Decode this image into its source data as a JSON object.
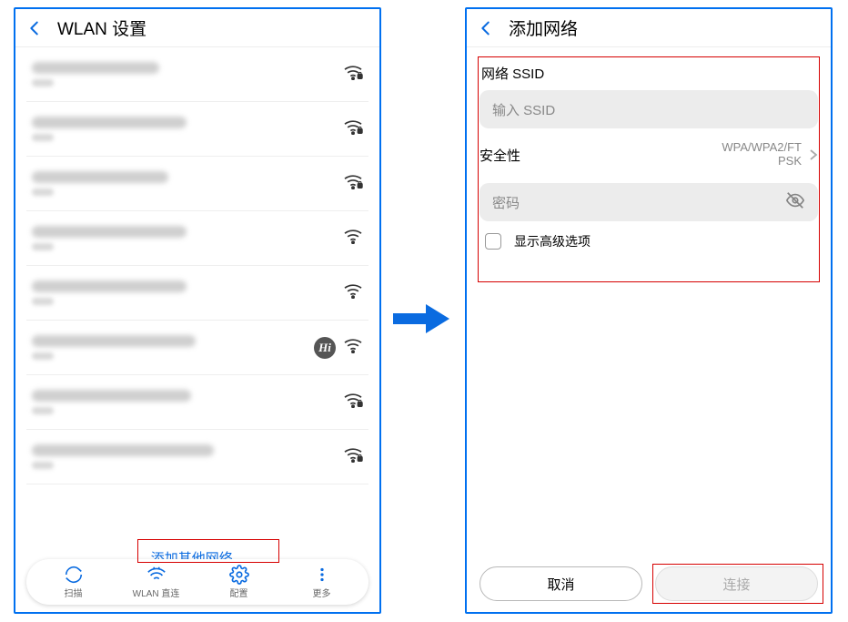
{
  "left": {
    "header_title": "WLAN 设置",
    "wifi_items": [
      {
        "name_width": 140,
        "has_lock": true,
        "hi": false
      },
      {
        "name_width": 170,
        "has_lock": true,
        "hi": false
      },
      {
        "name_width": 150,
        "has_lock": true,
        "hi": false
      },
      {
        "name_width": 170,
        "has_lock": false,
        "hi": false
      },
      {
        "name_width": 170,
        "has_lock": false,
        "hi": false
      },
      {
        "name_width": 180,
        "has_lock": false,
        "hi": true
      },
      {
        "name_width": 175,
        "has_lock": true,
        "hi": false
      },
      {
        "name_width": 200,
        "has_lock": true,
        "hi": false
      }
    ],
    "add_network_label": "添加其他网络...",
    "nav": {
      "scan": "扫描",
      "direct": "WLAN 直连",
      "config": "配置",
      "more": "更多"
    },
    "hi_badge": "Hi"
  },
  "right": {
    "header_title": "添加网络",
    "ssid_label": "网络 SSID",
    "ssid_placeholder": "输入 SSID",
    "security_label": "安全性",
    "security_value_l1": "WPA/WPA2/FT",
    "security_value_l2": "PSK",
    "password_placeholder": "密码",
    "advanced_label": "显示高级选项",
    "cancel_label": "取消",
    "connect_label": "连接"
  }
}
